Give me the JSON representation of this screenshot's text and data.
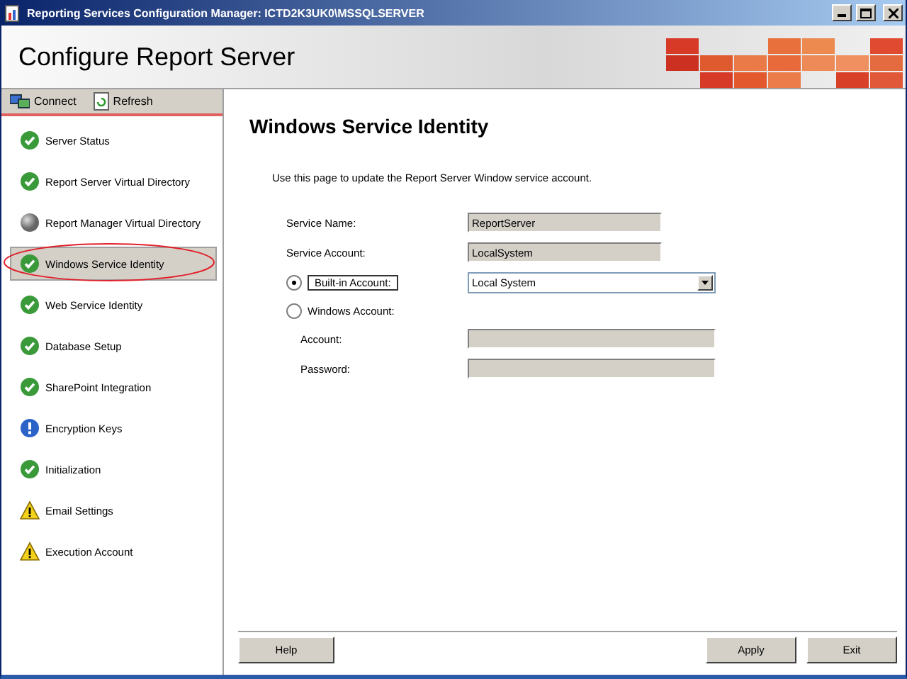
{
  "window": {
    "title": "Reporting Services Configuration Manager: ICTD2K3UK0\\MSSQLSERVER"
  },
  "header": {
    "title": "Configure Report Server"
  },
  "toolbar": [
    {
      "kind": "connect",
      "label": "Connect"
    },
    {
      "kind": "refresh",
      "label": "Refresh"
    }
  ],
  "sidebar": {
    "items": [
      {
        "label": "Server Status",
        "kind": "ok",
        "selected": false,
        "circled": false
      },
      {
        "label": "Report Server Virtual Directory",
        "kind": "ok",
        "selected": false,
        "circled": false
      },
      {
        "label": "Report Manager Virtual Directory",
        "kind": "unknown",
        "selected": false,
        "circled": false
      },
      {
        "label": "Windows Service Identity",
        "kind": "ok",
        "selected": true,
        "circled": true
      },
      {
        "label": "Web Service Identity",
        "kind": "ok",
        "selected": false,
        "circled": false
      },
      {
        "label": "Database Setup",
        "kind": "ok",
        "selected": false,
        "circled": false
      },
      {
        "label": "SharePoint Integration",
        "kind": "ok",
        "selected": false,
        "circled": false
      },
      {
        "label": "Encryption Keys",
        "kind": "info",
        "selected": false,
        "circled": false
      },
      {
        "label": "Initialization",
        "kind": "ok",
        "selected": false,
        "circled": false
      },
      {
        "label": "Email Settings",
        "kind": "warning",
        "selected": false,
        "circled": false
      },
      {
        "label": "Execution Account",
        "kind": "warning",
        "selected": false,
        "circled": false
      }
    ]
  },
  "page": {
    "title": "Windows Service Identity",
    "description": "Use this page to update the Report Server Window service account.",
    "fields": [
      {
        "kind": "text",
        "label": "Service Name:",
        "value": "ReportServer"
      },
      {
        "kind": "text",
        "label": "Service Account:",
        "value": "LocalSystem"
      },
      {
        "kind": "radio-select",
        "label": "Built-in Account:",
        "value": "Local System",
        "selected": true
      },
      {
        "kind": "radio",
        "label": "Windows Account:",
        "selected": false
      },
      {
        "kind": "indented-text",
        "label": "Account:"
      },
      {
        "kind": "indented-text",
        "label": "Password:"
      }
    ]
  },
  "buttons": [
    {
      "kind": "left",
      "label": "Help"
    },
    {
      "kind": "right",
      "label": "Apply"
    },
    {
      "kind": "right",
      "label": "Exit"
    }
  ]
}
